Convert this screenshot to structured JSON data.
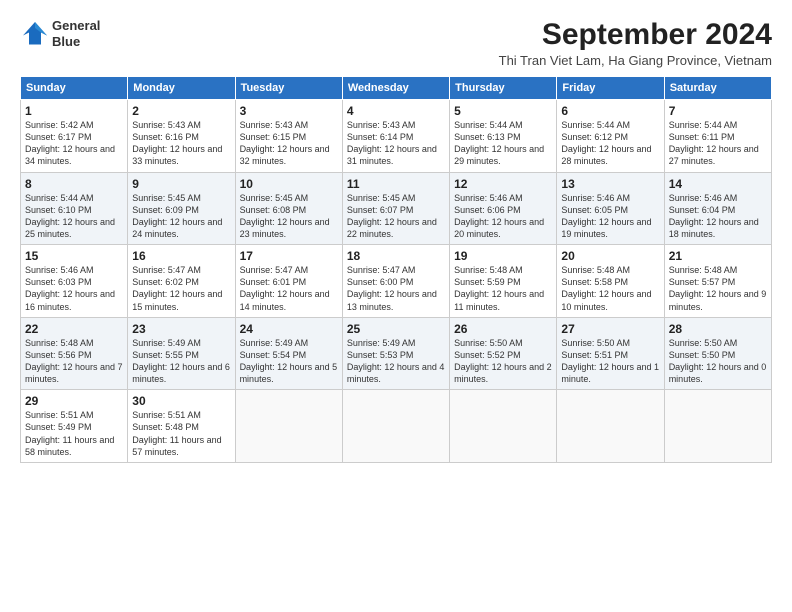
{
  "logo": {
    "line1": "General",
    "line2": "Blue"
  },
  "title": "September 2024",
  "subtitle": "Thi Tran Viet Lam, Ha Giang Province, Vietnam",
  "days": [
    "Sunday",
    "Monday",
    "Tuesday",
    "Wednesday",
    "Thursday",
    "Friday",
    "Saturday"
  ],
  "weeks": [
    [
      {
        "num": "1",
        "sunrise": "Sunrise: 5:42 AM",
        "sunset": "Sunset: 6:17 PM",
        "daylight": "Daylight: 12 hours and 34 minutes."
      },
      {
        "num": "2",
        "sunrise": "Sunrise: 5:43 AM",
        "sunset": "Sunset: 6:16 PM",
        "daylight": "Daylight: 12 hours and 33 minutes."
      },
      {
        "num": "3",
        "sunrise": "Sunrise: 5:43 AM",
        "sunset": "Sunset: 6:15 PM",
        "daylight": "Daylight: 12 hours and 32 minutes."
      },
      {
        "num": "4",
        "sunrise": "Sunrise: 5:43 AM",
        "sunset": "Sunset: 6:14 PM",
        "daylight": "Daylight: 12 hours and 31 minutes."
      },
      {
        "num": "5",
        "sunrise": "Sunrise: 5:44 AM",
        "sunset": "Sunset: 6:13 PM",
        "daylight": "Daylight: 12 hours and 29 minutes."
      },
      {
        "num": "6",
        "sunrise": "Sunrise: 5:44 AM",
        "sunset": "Sunset: 6:12 PM",
        "daylight": "Daylight: 12 hours and 28 minutes."
      },
      {
        "num": "7",
        "sunrise": "Sunrise: 5:44 AM",
        "sunset": "Sunset: 6:11 PM",
        "daylight": "Daylight: 12 hours and 27 minutes."
      }
    ],
    [
      {
        "num": "8",
        "sunrise": "Sunrise: 5:44 AM",
        "sunset": "Sunset: 6:10 PM",
        "daylight": "Daylight: 12 hours and 25 minutes."
      },
      {
        "num": "9",
        "sunrise": "Sunrise: 5:45 AM",
        "sunset": "Sunset: 6:09 PM",
        "daylight": "Daylight: 12 hours and 24 minutes."
      },
      {
        "num": "10",
        "sunrise": "Sunrise: 5:45 AM",
        "sunset": "Sunset: 6:08 PM",
        "daylight": "Daylight: 12 hours and 23 minutes."
      },
      {
        "num": "11",
        "sunrise": "Sunrise: 5:45 AM",
        "sunset": "Sunset: 6:07 PM",
        "daylight": "Daylight: 12 hours and 22 minutes."
      },
      {
        "num": "12",
        "sunrise": "Sunrise: 5:46 AM",
        "sunset": "Sunset: 6:06 PM",
        "daylight": "Daylight: 12 hours and 20 minutes."
      },
      {
        "num": "13",
        "sunrise": "Sunrise: 5:46 AM",
        "sunset": "Sunset: 6:05 PM",
        "daylight": "Daylight: 12 hours and 19 minutes."
      },
      {
        "num": "14",
        "sunrise": "Sunrise: 5:46 AM",
        "sunset": "Sunset: 6:04 PM",
        "daylight": "Daylight: 12 hours and 18 minutes."
      }
    ],
    [
      {
        "num": "15",
        "sunrise": "Sunrise: 5:46 AM",
        "sunset": "Sunset: 6:03 PM",
        "daylight": "Daylight: 12 hours and 16 minutes."
      },
      {
        "num": "16",
        "sunrise": "Sunrise: 5:47 AM",
        "sunset": "Sunset: 6:02 PM",
        "daylight": "Daylight: 12 hours and 15 minutes."
      },
      {
        "num": "17",
        "sunrise": "Sunrise: 5:47 AM",
        "sunset": "Sunset: 6:01 PM",
        "daylight": "Daylight: 12 hours and 14 minutes."
      },
      {
        "num": "18",
        "sunrise": "Sunrise: 5:47 AM",
        "sunset": "Sunset: 6:00 PM",
        "daylight": "Daylight: 12 hours and 13 minutes."
      },
      {
        "num": "19",
        "sunrise": "Sunrise: 5:48 AM",
        "sunset": "Sunset: 5:59 PM",
        "daylight": "Daylight: 12 hours and 11 minutes."
      },
      {
        "num": "20",
        "sunrise": "Sunrise: 5:48 AM",
        "sunset": "Sunset: 5:58 PM",
        "daylight": "Daylight: 12 hours and 10 minutes."
      },
      {
        "num": "21",
        "sunrise": "Sunrise: 5:48 AM",
        "sunset": "Sunset: 5:57 PM",
        "daylight": "Daylight: 12 hours and 9 minutes."
      }
    ],
    [
      {
        "num": "22",
        "sunrise": "Sunrise: 5:48 AM",
        "sunset": "Sunset: 5:56 PM",
        "daylight": "Daylight: 12 hours and 7 minutes."
      },
      {
        "num": "23",
        "sunrise": "Sunrise: 5:49 AM",
        "sunset": "Sunset: 5:55 PM",
        "daylight": "Daylight: 12 hours and 6 minutes."
      },
      {
        "num": "24",
        "sunrise": "Sunrise: 5:49 AM",
        "sunset": "Sunset: 5:54 PM",
        "daylight": "Daylight: 12 hours and 5 minutes."
      },
      {
        "num": "25",
        "sunrise": "Sunrise: 5:49 AM",
        "sunset": "Sunset: 5:53 PM",
        "daylight": "Daylight: 12 hours and 4 minutes."
      },
      {
        "num": "26",
        "sunrise": "Sunrise: 5:50 AM",
        "sunset": "Sunset: 5:52 PM",
        "daylight": "Daylight: 12 hours and 2 minutes."
      },
      {
        "num": "27",
        "sunrise": "Sunrise: 5:50 AM",
        "sunset": "Sunset: 5:51 PM",
        "daylight": "Daylight: 12 hours and 1 minute."
      },
      {
        "num": "28",
        "sunrise": "Sunrise: 5:50 AM",
        "sunset": "Sunset: 5:50 PM",
        "daylight": "Daylight: 12 hours and 0 minutes."
      }
    ],
    [
      {
        "num": "29",
        "sunrise": "Sunrise: 5:51 AM",
        "sunset": "Sunset: 5:49 PM",
        "daylight": "Daylight: 11 hours and 58 minutes."
      },
      {
        "num": "30",
        "sunrise": "Sunrise: 5:51 AM",
        "sunset": "Sunset: 5:48 PM",
        "daylight": "Daylight: 11 hours and 57 minutes."
      },
      null,
      null,
      null,
      null,
      null
    ]
  ]
}
